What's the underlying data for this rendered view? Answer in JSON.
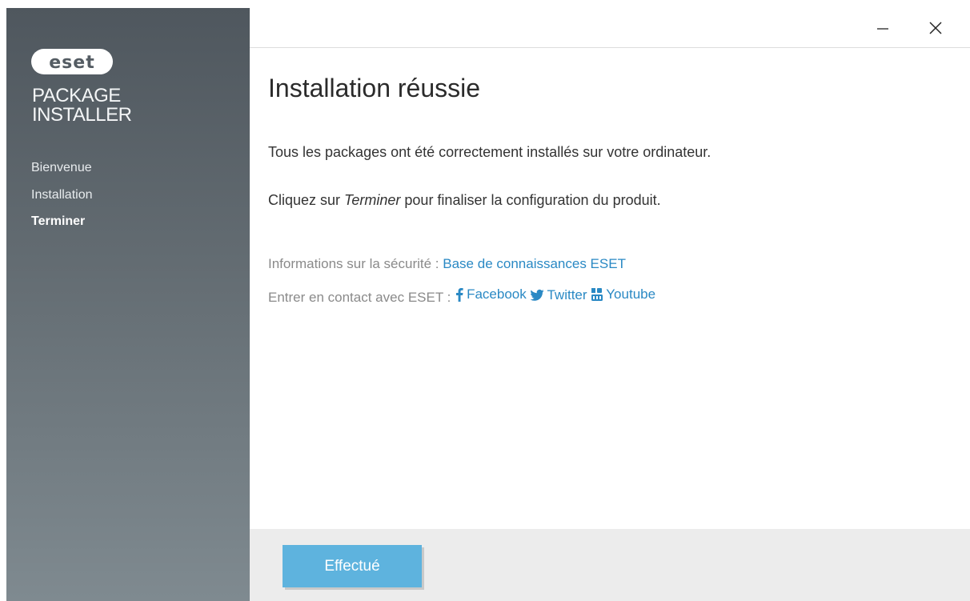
{
  "sidebar": {
    "logo_text": "eset",
    "product_line1": "PACKAGE",
    "product_line2": "INSTALLER",
    "steps": [
      {
        "label": "Bienvenue"
      },
      {
        "label": "Installation"
      },
      {
        "label": "Terminer"
      }
    ],
    "active_step": "Terminer"
  },
  "titlebar": {
    "minimize_icon": "minimize-icon",
    "close_icon": "close-icon"
  },
  "main": {
    "title": "Installation réussie",
    "message1": "Tous les packages ont été correctement installés sur votre ordinateur.",
    "message2_prefix": "Cliquez sur ",
    "message2_emphasis": "Terminer",
    "message2_suffix": " pour finaliser la configuration du produit.",
    "security_label": "Informations sur la sécurité : ",
    "security_link": "Base de connaissances ESET",
    "contact_label": "Entrer en contact avec ESET : ",
    "social": {
      "facebook": "Facebook",
      "twitter": "Twitter",
      "youtube": "Youtube"
    }
  },
  "footer": {
    "done_label": "Effectué"
  },
  "colors": {
    "accent": "#5eb3de",
    "link": "#2a89c4",
    "sidebar_top": "#4f575e",
    "sidebar_bottom": "#7f8a90"
  }
}
